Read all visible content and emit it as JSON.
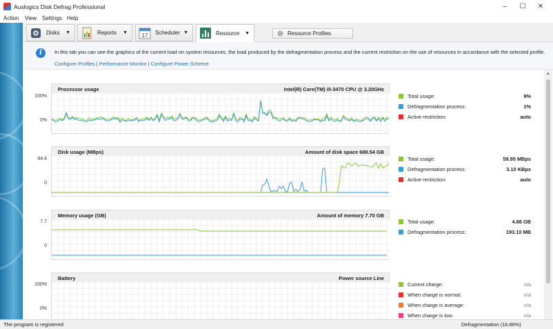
{
  "window": {
    "title": "Auslogics Disk Defrag Professional"
  },
  "menu": [
    "Action",
    "View",
    "Settings",
    "Help"
  ],
  "tabs": [
    {
      "label": "Disks",
      "icon": "disks-icon"
    },
    {
      "label": "Reports",
      "icon": "reports-icon"
    },
    {
      "label": "Scheduler",
      "icon": "scheduler-icon",
      "calendar_day": "17"
    },
    {
      "label": "Resource",
      "icon": "resource-icon"
    }
  ],
  "resource_profiles_button": "Resource Profiles",
  "info": {
    "text": "In this tab you can see the graphics of the current load on system resources, the load produced by the defragmentation process and the current restriction on the use of resources in accordance with the selected profile.",
    "links": [
      "Configure Profiles",
      "Performance Monitor",
      "Configure Power Scheme"
    ],
    "separator": "|"
  },
  "colors": {
    "green": "#8cc63f",
    "blue": "#3a9bd5",
    "red": "#e03030",
    "orange": "#f07830",
    "pink": "#e8407a"
  },
  "panels": [
    {
      "title": "Processor usage",
      "right": "Intel(R) Core(TM) i5-3470 CPU @ 3.20GHz",
      "ymax": "100%",
      "ymin": "0%",
      "legend": [
        {
          "label": "Total usage:",
          "value": "9%",
          "color": "#8cc63f"
        },
        {
          "label": "Defragmentation process:",
          "value": "1%",
          "color": "#3a9bd5"
        },
        {
          "label": "Active restriction:",
          "value": "auto",
          "color": "#e03030"
        }
      ]
    },
    {
      "title": "Disk usage (MBps)",
      "right": "Amount of disk space 688.54 GB",
      "ymax": "94.4",
      "ymin": "0",
      "legend": [
        {
          "label": "Total usage:",
          "value": "59.95 MBps",
          "color": "#8cc63f"
        },
        {
          "label": "Defragmentation process:",
          "value": "3.10 KBps",
          "color": "#3a9bd5"
        },
        {
          "label": "Active restriction:",
          "value": "auto",
          "color": "#e03030"
        }
      ]
    },
    {
      "title": "Memory usage (GB)",
      "right": "Amount of memory 7.70 GB",
      "ymax": "7.7",
      "ymin": "0",
      "legend": [
        {
          "label": "Total usage:",
          "value": "4.88 GB",
          "color": "#8cc63f"
        },
        {
          "label": "Defragmentation process:",
          "value": "193.10 MB",
          "color": "#3a9bd5"
        }
      ]
    },
    {
      "title": "Battery",
      "right": "Power source Line",
      "ymax": "100%",
      "ymin": "0%",
      "legend": [
        {
          "label": "Current charge:",
          "value": "n/a",
          "color": "#8cc63f"
        },
        {
          "label": "When charge is normal:",
          "value": "n/a",
          "color": "#e03030"
        },
        {
          "label": "When charge is average:",
          "value": "n/a",
          "color": "#f07830"
        },
        {
          "label": "When charge is low:",
          "value": "n/a",
          "color": "#e8407a"
        }
      ]
    }
  ],
  "status": {
    "left": "The program is registered",
    "right": "Defragmentation (16.86%)"
  }
}
